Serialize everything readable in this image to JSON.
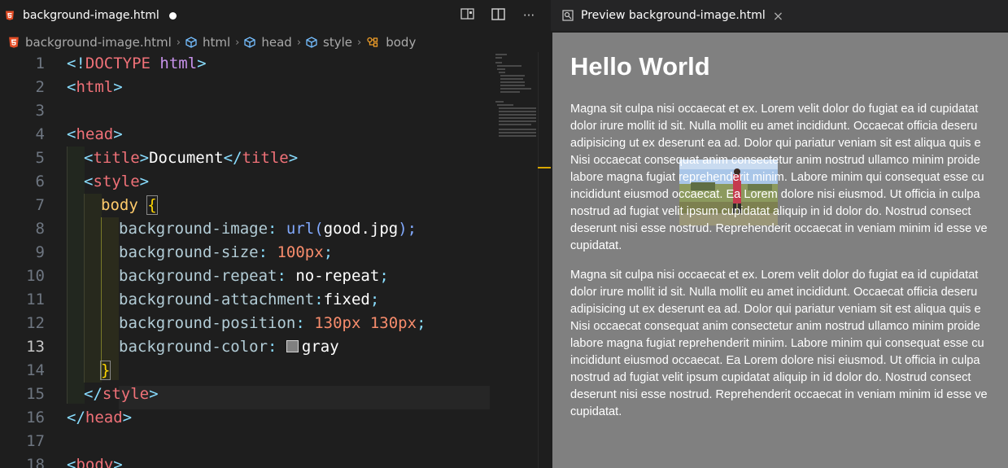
{
  "editor": {
    "tab": {
      "file_name": "background-image.html"
    },
    "actions": {
      "open_preview": "open-preview-to-side",
      "split": "split-editor",
      "more": "···"
    },
    "breadcrumb": [
      "background-image.html",
      "html",
      "head",
      "style",
      "body"
    ],
    "line_numbers": [
      "1",
      "2",
      "3",
      "4",
      "5",
      "6",
      "7",
      "8",
      "9",
      "10",
      "11",
      "12",
      "13",
      "14",
      "15",
      "16",
      "17",
      "18"
    ],
    "code_tokens": {
      "l1": [
        "<!",
        "DOCTYPE",
        " html",
        ">"
      ],
      "l2": [
        "<",
        "html",
        ">"
      ],
      "l4": [
        "<",
        "head",
        ">"
      ],
      "l5": [
        "<",
        "title",
        ">",
        "Document",
        "</",
        "title",
        ">"
      ],
      "l6": [
        "<",
        "style",
        ">"
      ],
      "l7": [
        "body",
        " ",
        "{"
      ],
      "l8": [
        "background-image",
        ": ",
        "url(",
        "good.jpg",
        ");"
      ],
      "l9": [
        "background-size",
        ": ",
        "100px",
        ";"
      ],
      "l10": [
        "background-repeat",
        ": ",
        "no-repeat",
        ";"
      ],
      "l11": [
        "background-attachment",
        ":",
        "fixed",
        ";"
      ],
      "l12": [
        "background-position",
        ": ",
        "130px 130px",
        ";"
      ],
      "l13": [
        "background-color",
        ": ",
        "gray"
      ],
      "l14": [
        "}"
      ],
      "l15": [
        "</",
        "style",
        ">"
      ],
      "l16": [
        "</",
        "head",
        ">"
      ],
      "l18": [
        "<",
        "body",
        ">"
      ]
    },
    "swatch_color": "#808080"
  },
  "preview": {
    "tab_label": "Preview background-image.html",
    "close": "×",
    "heading": "Hello World",
    "paragraph_lines": [
      "Magna sit culpa nisi occaecat et ex. Lorem velit dolor do fugiat ea id cupidatat",
      "dolor irure mollit id sit. Nulla mollit eu amet incididunt. Occaecat officia deseru",
      "adipisicing ut ex deserunt ea ad. Dolor qui pariatur veniam sit est aliqua quis e",
      "Nisi occaecat consequat anim consectetur anim nostrud ullamco minim proide",
      "labore magna fugiat reprehenderit minim. Labore minim qui consequat esse cu",
      "incididunt eiusmod occaecat. Ea Lorem dolore nisi eiusmod. Ut officia in culpa",
      "nostrud ad fugiat velit ipsum cupidatat aliquip in id dolor do. Nostrud consect",
      "deserunt nisi esse nostrud. Reprehenderit occaecat in veniam minim id esse ve",
      "cupidatat."
    ],
    "page_background": "#808080"
  }
}
